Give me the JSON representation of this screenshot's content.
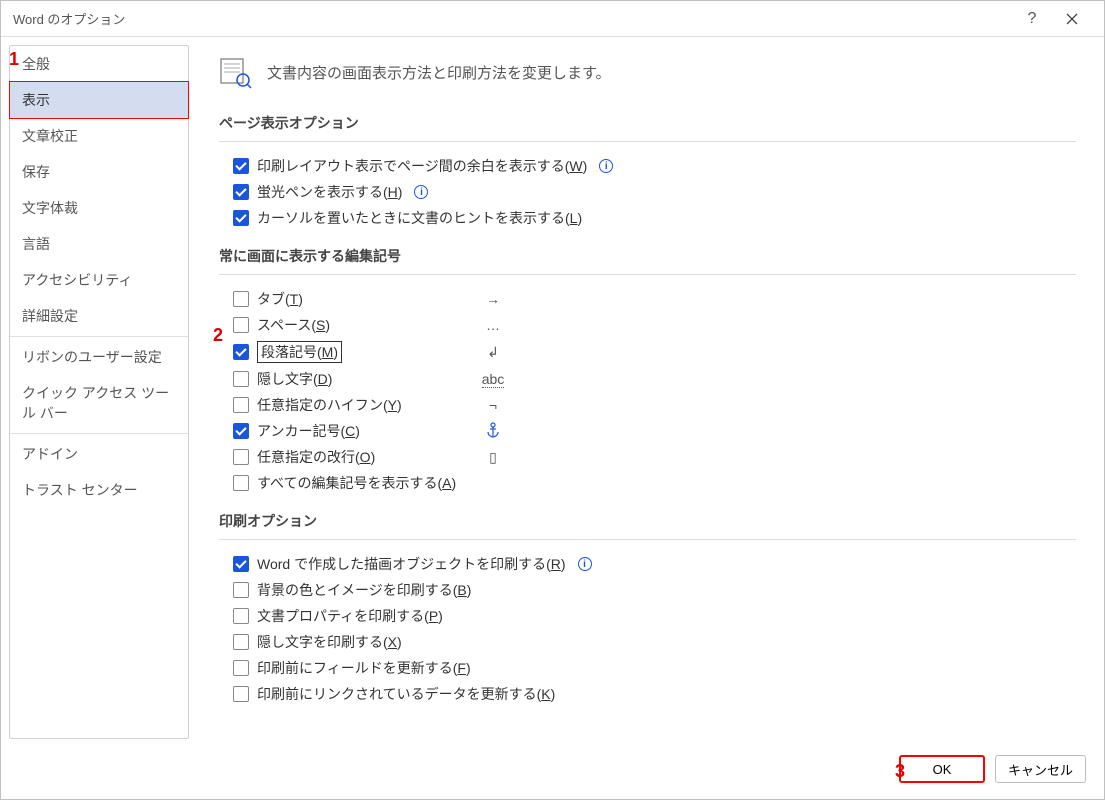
{
  "window": {
    "title": "Word のオプション"
  },
  "header": {
    "description": "文書内容の画面表示方法と印刷方法を変更します。"
  },
  "sidebar": {
    "items": [
      {
        "label": "全般",
        "active": false
      },
      {
        "label": "表示",
        "active": true
      },
      {
        "label": "文章校正",
        "active": false
      },
      {
        "label": "保存",
        "active": false
      },
      {
        "label": "文字体裁",
        "active": false
      },
      {
        "label": "言語",
        "active": false
      },
      {
        "label": "アクセシビリティ",
        "active": false
      },
      {
        "label": "詳細設定",
        "active": false
      },
      {
        "label": "リボンのユーザー設定",
        "active": false,
        "sep_before": true
      },
      {
        "label": "クイック アクセス ツール バー",
        "active": false
      },
      {
        "label": "アドイン",
        "active": false,
        "sep_before": true
      },
      {
        "label": "トラスト センター",
        "active": false
      }
    ]
  },
  "sections": {
    "page_display": {
      "title": "ページ表示オプション",
      "options": [
        {
          "checked": true,
          "label": "印刷レイアウト表示でページ間の余白を表示する(",
          "key": "W",
          "suffix": ")",
          "info": true
        },
        {
          "checked": true,
          "label": "蛍光ペンを表示する(",
          "key": "H",
          "suffix": ")",
          "info": true
        },
        {
          "checked": true,
          "label": "カーソルを置いたときに文書のヒントを表示する(",
          "key": "L",
          "suffix": ")",
          "info": false
        }
      ]
    },
    "formatting_marks": {
      "title": "常に画面に表示する編集記号",
      "options": [
        {
          "checked": false,
          "label": "タブ(",
          "key": "T",
          "suffix": ")",
          "symbol": "→"
        },
        {
          "checked": false,
          "label": "スペース(",
          "key": "S",
          "suffix": ")",
          "symbol": "…"
        },
        {
          "checked": true,
          "label": "段落記号(",
          "key": "M",
          "suffix": ")",
          "symbol": "↲",
          "highlighted": true
        },
        {
          "checked": false,
          "label": "隠し文字(",
          "key": "D",
          "suffix": ")",
          "symbol": "abc",
          "symbol_underline": true
        },
        {
          "checked": false,
          "label": "任意指定のハイフン(",
          "key": "Y",
          "suffix": ")",
          "symbol": "¬"
        },
        {
          "checked": true,
          "label": "アンカー記号(",
          "key": "C",
          "suffix": ")",
          "symbol_icon": "anchor"
        },
        {
          "checked": false,
          "label": "任意指定の改行(",
          "key": "O",
          "suffix": ")",
          "symbol": "▯"
        },
        {
          "checked": false,
          "label": "すべての編集記号を表示する(",
          "key": "A",
          "suffix": ")"
        }
      ]
    },
    "print": {
      "title": "印刷オプション",
      "options": [
        {
          "checked": true,
          "label": "Word で作成した描画オブジェクトを印刷する(",
          "key": "R",
          "suffix": ")",
          "info": true
        },
        {
          "checked": false,
          "label": "背景の色とイメージを印刷する(",
          "key": "B",
          "suffix": ")"
        },
        {
          "checked": false,
          "label": "文書プロパティを印刷する(",
          "key": "P",
          "suffix": ")"
        },
        {
          "checked": false,
          "label": "隠し文字を印刷する(",
          "key": "X",
          "suffix": ")"
        },
        {
          "checked": false,
          "label": "印刷前にフィールドを更新する(",
          "key": "F",
          "suffix": ")"
        },
        {
          "checked": false,
          "label": "印刷前にリンクされているデータを更新する(",
          "key": "K",
          "suffix": ")"
        }
      ]
    }
  },
  "footer": {
    "ok": "OK",
    "cancel": "キャンセル"
  },
  "annotations": {
    "a1": "1",
    "a2": "2",
    "a3": "3"
  }
}
